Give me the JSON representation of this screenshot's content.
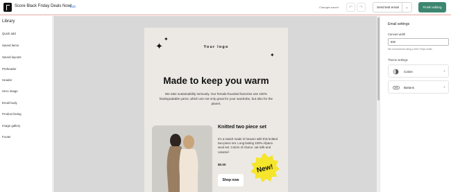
{
  "header": {
    "title": "Score Black Friday Deals Now!",
    "edit": "Edit",
    "status": "Changes saved",
    "undo": "↶",
    "redo": "↷",
    "send_test": "Send test email",
    "send_test_caret": "⌄",
    "finish": "Finish editing"
  },
  "sidebar": {
    "heading": "Library",
    "items": [
      "Quick add",
      "Saved items",
      "Saved layouts",
      "Preheader",
      "Header",
      "Hero image",
      "Email body",
      "Product listing",
      "Image gallery",
      "Footer"
    ]
  },
  "email": {
    "logo": "Your logo",
    "headline": "Made to keep you warm",
    "body": "We take sustainability seriously. Our female-founded factories use 100% biodegradable yarns, which are not only great for your wardrobe, but also for the planet.",
    "product": {
      "title": "Knitted two piece set",
      "description": "It's a match made in heaven with this knitted two-piece set. Long lasting 100% Alpaca wool set. Colors of choice: oat milk and caramel",
      "price": "$0.00",
      "button": "Shop now",
      "badge": "New!"
    }
  },
  "settings": {
    "heading": "Email settings",
    "canvas_width_label": "Canvas width",
    "canvas_width_value": "600",
    "canvas_width_hint": "We recommend using a 600-700px width",
    "theme_label": "Theme settings",
    "theme_items": [
      {
        "label": "Colors",
        "icon": "colors-icon"
      },
      {
        "label": "Buttons",
        "icon": "buttons-icon"
      }
    ],
    "chevron": "›"
  },
  "colors": {
    "accent": "#3d8670",
    "link": "#2c6ecb",
    "badge": "#f5e52b",
    "email_bg": "#ece9e4",
    "canvas_bg": "#d8d8d8"
  }
}
